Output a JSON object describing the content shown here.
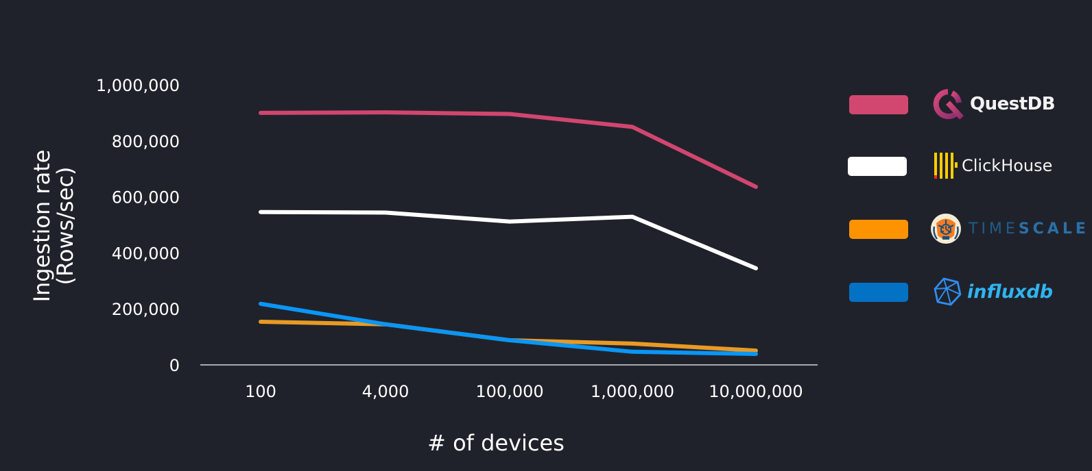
{
  "chart_data": {
    "type": "line",
    "title": "",
    "xlabel": "# of devices",
    "ylabel_lines": [
      "Ingestion rate",
      "(Rows/sec)"
    ],
    "categories": [
      "100",
      "4,000",
      "100,000",
      "1,000,000",
      "10,000,000"
    ],
    "ylim": [
      0,
      1000000
    ],
    "yticks": [
      0,
      200000,
      400000,
      600000,
      800000,
      1000000
    ],
    "ytick_labels": [
      "0",
      "200,000",
      "400,000",
      "600,000",
      "800,000",
      "1,000,000"
    ],
    "grid": false,
    "legend_position": "right",
    "series": [
      {
        "name": "QuestDB",
        "color": "#d1466f",
        "values": [
          900000,
          902000,
          896000,
          850000,
          636000
        ]
      },
      {
        "name": "ClickHouse",
        "color": "#ffffff",
        "values": [
          546000,
          544000,
          512000,
          529000,
          345000
        ]
      },
      {
        "name": "Timescale",
        "color": "#e89a26",
        "values": [
          154000,
          145000,
          88000,
          76000,
          51000
        ]
      },
      {
        "name": "InfluxDB",
        "color": "#0a96f5",
        "values": [
          218000,
          145000,
          88000,
          47000,
          39000
        ]
      }
    ]
  },
  "legend": {
    "items": [
      {
        "name": "QuestDB",
        "swatch_color": "#d2476f",
        "logo_text": "QuestDB",
        "icon": "questdb-logo-icon"
      },
      {
        "name": "ClickHouse",
        "swatch_color": "#ffffff",
        "logo_text": "ClickHouse",
        "icon": "clickhouse-logo-icon"
      },
      {
        "name": "Timescale",
        "swatch_color": "#fe9300",
        "logo_text_light": "TIME",
        "logo_text_bold": "SCALE",
        "icon": "timescale-tiger-logo-icon"
      },
      {
        "name": "InfluxDB",
        "swatch_color": "#0472c4",
        "logo_text": "influxdb",
        "icon": "influxdb-logo-icon"
      }
    ]
  }
}
